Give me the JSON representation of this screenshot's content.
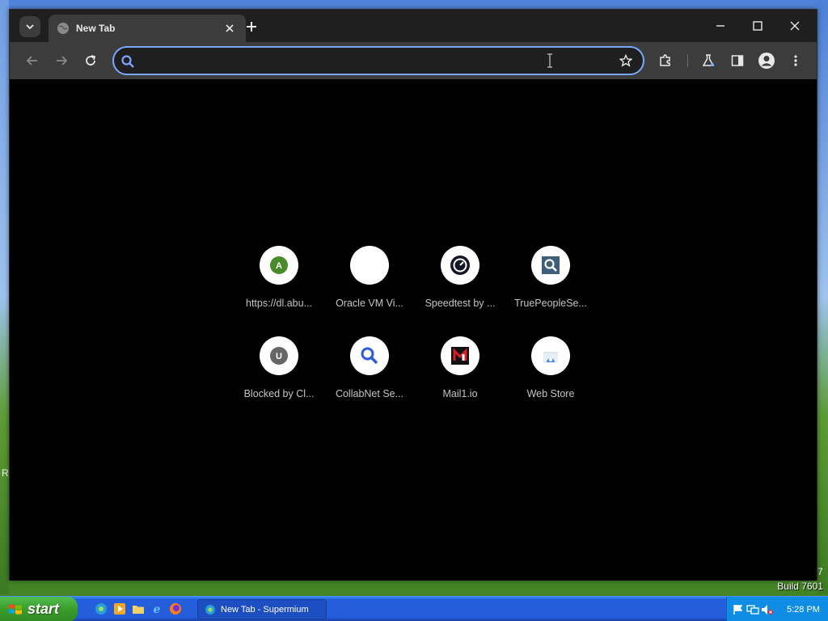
{
  "browser": {
    "tab": {
      "title": "New Tab"
    },
    "omnibox": {
      "value": "",
      "placeholder": ""
    },
    "accent": "#7aa7ff"
  },
  "shortcuts": [
    {
      "label": "https://dl.abu...",
      "icon": "letter-a-icon",
      "letter": "A",
      "color": "#4a8a2a"
    },
    {
      "label": "Oracle VM Vi...",
      "icon": "blank-icon",
      "letter": "",
      "color": "#ffffff"
    },
    {
      "label": "Speedtest by ...",
      "icon": "speedometer-icon",
      "letter": "",
      "color": "#141526"
    },
    {
      "label": "TruePeopleSe...",
      "icon": "magnifier-square-icon",
      "letter": "",
      "color": "#3d5f7c"
    },
    {
      "label": "Blocked by Cl...",
      "icon": "letter-u-icon",
      "letter": "U",
      "color": "#666666"
    },
    {
      "label": "CollabNet Se...",
      "icon": "magnifier-icon",
      "letter": "",
      "color": "#2e5bd6"
    },
    {
      "label": "Mail1.io",
      "icon": "mail1-logo-icon",
      "letter": "",
      "color": "#d41f26"
    },
    {
      "label": "Web Store",
      "icon": "web-store-icon",
      "letter": "",
      "color": "#4285f4"
    }
  ],
  "desktop": {
    "build": "Build 7601",
    "stray_left": "R",
    "stray_right": "7"
  },
  "taskbar": {
    "start_label": "start",
    "active_task": "New Tab - Supermium",
    "clock": "5:28 PM"
  }
}
